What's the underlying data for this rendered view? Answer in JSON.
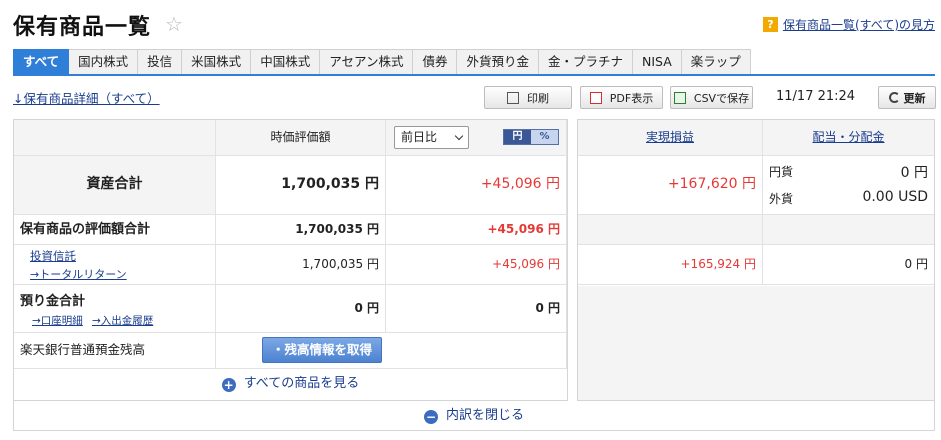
{
  "header": {
    "title": "保有商品一覧",
    "star_icon": "☆",
    "help_badge": "?",
    "help_link": "保有商品一覧(すべて)の見方"
  },
  "tabs": [
    {
      "label": "すべて",
      "active": true
    },
    {
      "label": "国内株式"
    },
    {
      "label": "投信"
    },
    {
      "label": "米国株式"
    },
    {
      "label": "中国株式"
    },
    {
      "label": "アセアン株式"
    },
    {
      "label": "債券"
    },
    {
      "label": "外貨預り金"
    },
    {
      "label": "金・プラチナ"
    },
    {
      "label": "NISA"
    },
    {
      "label": "楽ラップ"
    }
  ],
  "toolbar": {
    "detail_link": "↓保有商品詳細（すべて）",
    "print_label": "印刷",
    "pdf_label": "PDF表示",
    "csv_label": "CSVで保存",
    "timestamp": "11/17 21:24",
    "refresh_label": "更新"
  },
  "table": {
    "col_market_value": "時価評価額",
    "period_select": "前日比",
    "toggle_yen": "円",
    "toggle_pct": "%",
    "col_realized": "実現損益",
    "col_dividend": "配当・分配金",
    "total": {
      "label": "資産合計",
      "value": "1,700,035 円",
      "change": "+45,096 円",
      "realized": "+167,620 円",
      "div_jpy_label": "円貨",
      "div_jpy_value": "0 円",
      "div_fx_label": "外貨",
      "div_fx_value": "0.00 USD"
    },
    "holdings": {
      "label": "保有商品の評価額合計",
      "value": "1,700,035 円",
      "change": "+45,096 円"
    },
    "fund": {
      "label": "投資信託",
      "sub_link": "→トータルリターン",
      "value": "1,700,035 円",
      "change": "+45,096 円",
      "realized": "+165,924 円",
      "dividend": "0 円"
    },
    "deposit": {
      "label": "預り金合計",
      "link_account": "→口座明細",
      "link_history": "→入出金履歴",
      "value": "0 円",
      "change": "0 円"
    },
    "bank": {
      "label": "楽天銀行普通預金残高",
      "button": "・残高情報を取得"
    },
    "show_all": "すべての商品を見る",
    "close_breakdown": "内訳を閉じる"
  },
  "colors": {
    "accent": "#2f7ed8",
    "positive": "#e53935"
  }
}
